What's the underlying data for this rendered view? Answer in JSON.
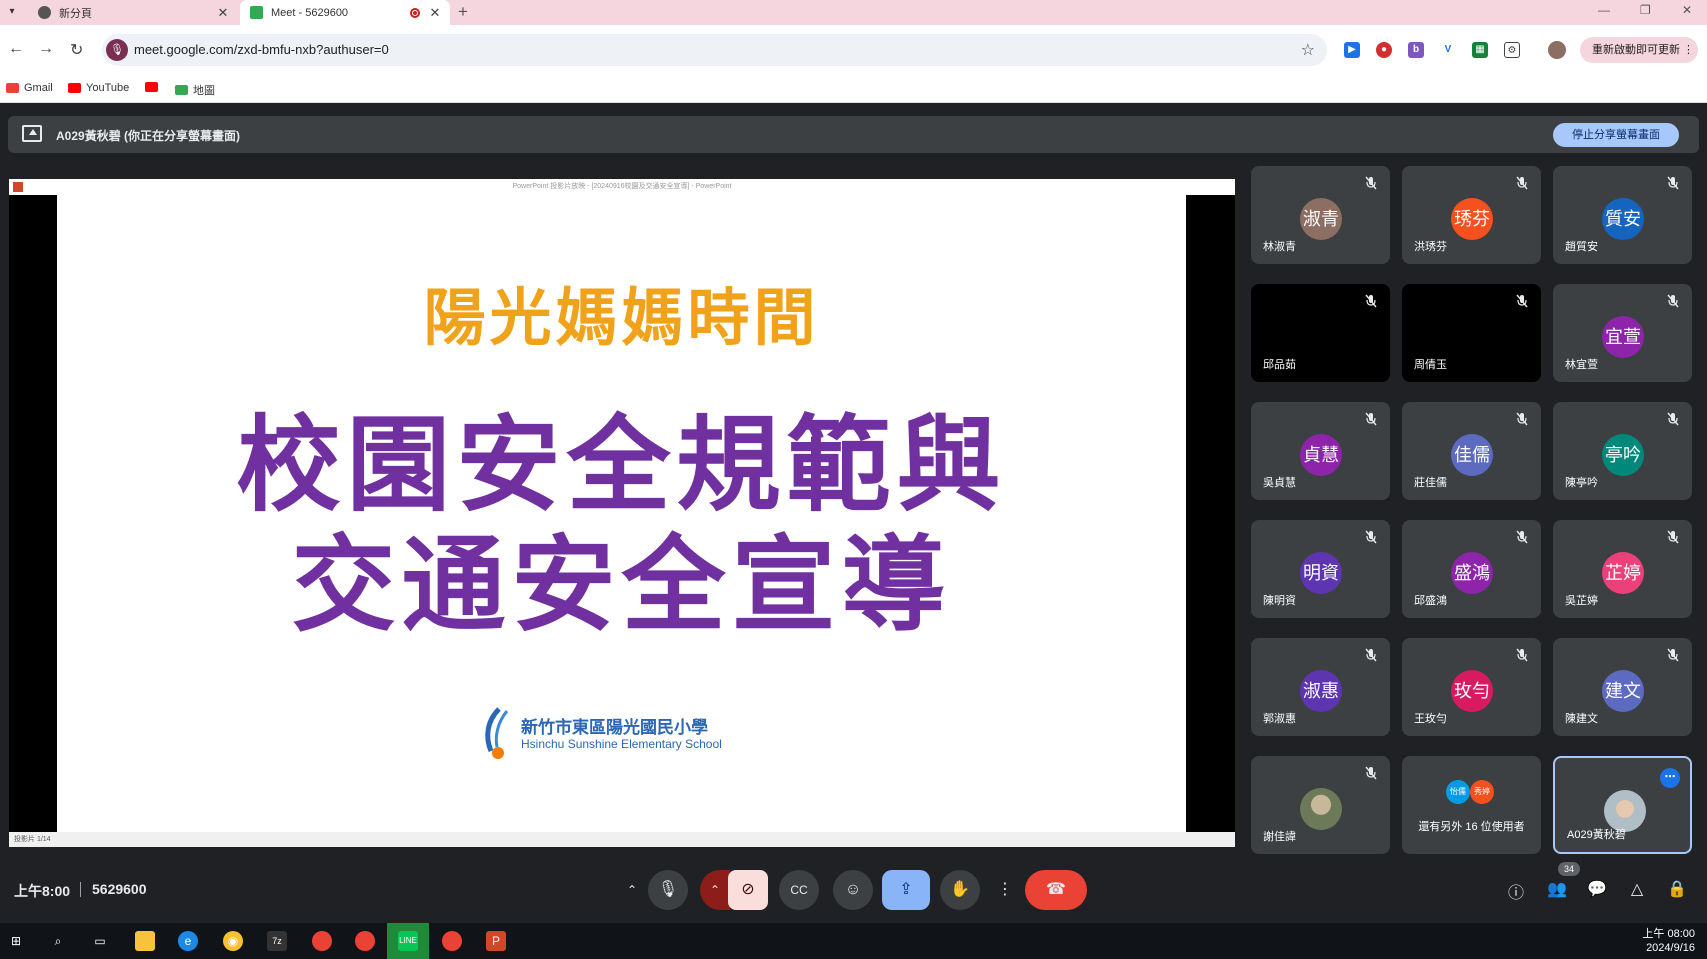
{
  "browser": {
    "tabs": [
      {
        "title": "新分頁",
        "active": false
      },
      {
        "title": "Meet - 5629600",
        "active": true
      }
    ],
    "url": "meet.google.com/zxd-bmfu-nxb?authuser=0",
    "update_label": "重新啟動即可更新",
    "bookmarks": [
      {
        "label": "Gmail"
      },
      {
        "label": "YouTube"
      },
      {
        "label": ""
      },
      {
        "label": "地圖"
      }
    ]
  },
  "meet": {
    "share_banner": "A029黃秋碧 (你正在分享螢幕畫面)",
    "stop_share_label": "停止分享螢幕畫面",
    "time": "上午8:00",
    "meeting_code": "5629600",
    "participants_count": "34"
  },
  "presentation": {
    "window_title": "PowerPoint 投影片放映 - [20240916校園及交通安全宣導] - PowerPoint",
    "title_line": "陽光媽媽時間",
    "main_line1": "校園安全規範與",
    "main_line2": "交通安全宣導",
    "school_zh": "新竹市東區陽光國民小學",
    "school_en": "Hsinchu Sunshine Elementary School",
    "status": "投影片 1/14",
    "colors": {
      "title": "#f0a21b",
      "main": "#7030a0",
      "school": "#2b67b7"
    }
  },
  "participants": [
    {
      "initials": "淑青",
      "name": "林淑青",
      "color": "#8d6e63"
    },
    {
      "initials": "琇芬",
      "name": "洪琇芬",
      "color": "#f4511e"
    },
    {
      "initials": "質安",
      "name": "趙質安",
      "color": "#1565c0"
    },
    {
      "initials": "",
      "name": "邱品茹",
      "color": ""
    },
    {
      "initials": "",
      "name": "周倩玉",
      "color": ""
    },
    {
      "initials": "宜萱",
      "name": "林宜萱",
      "color": "#8e24aa"
    },
    {
      "initials": "貞慧",
      "name": "吳貞慧",
      "color": "#8e24aa"
    },
    {
      "initials": "佳儒",
      "name": "莊佳儒",
      "color": "#5c6bc0"
    },
    {
      "initials": "亭吟",
      "name": "陳亭吟",
      "color": "#00897b"
    },
    {
      "initials": "明資",
      "name": "陳明資",
      "color": "#5e35b1"
    },
    {
      "initials": "盛鴻",
      "name": "邱盛鴻",
      "color": "#8e24aa"
    },
    {
      "initials": "芷婷",
      "name": "吳芷婷",
      "color": "#ec407a"
    },
    {
      "initials": "淑惠",
      "name": "郭淑惠",
      "color": "#5e35b1"
    },
    {
      "initials": "玫勻",
      "name": "王玫勻",
      "color": "#d81b60"
    },
    {
      "initials": "建文",
      "name": "陳建文",
      "color": "#5c6bc0"
    },
    {
      "initials": "",
      "name": "謝佳諱",
      "color": ""
    }
  ],
  "others_tile": {
    "label": "還有另外 16 位使用者",
    "mini_avatars": [
      {
        "initials": "怡儒",
        "color": "#039be5"
      },
      {
        "initials": "秀婷",
        "color": "#f4511e"
      }
    ]
  },
  "self_tile": {
    "name": "A029黃秋碧"
  },
  "taskbar": {
    "time": "上午 08:00",
    "date": "2024/9/16"
  }
}
